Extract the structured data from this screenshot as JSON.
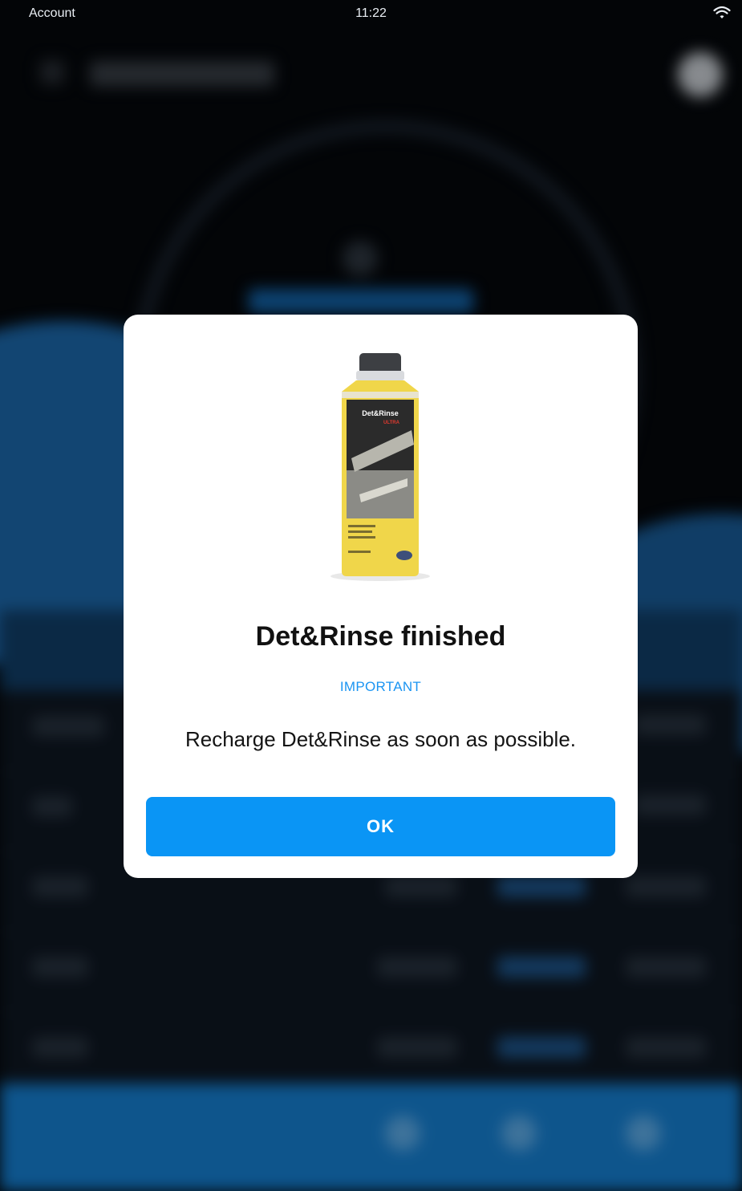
{
  "status_bar": {
    "carrier": "Account",
    "time": "11:22",
    "wifi_icon": "wifi-icon"
  },
  "dialog": {
    "image_icon": "det-rinse-bottle",
    "image_label": "Det&Rinse",
    "image_sublabel": "ULTRA",
    "title": "Det&Rinse finished",
    "tag": "IMPORTANT",
    "message": "Recharge Det&Rinse as soon as possible.",
    "ok_label": "OK"
  },
  "colors": {
    "accent": "#0a95f5",
    "tag": "#1a94f2",
    "bottle_yellow": "#f0d64a"
  }
}
